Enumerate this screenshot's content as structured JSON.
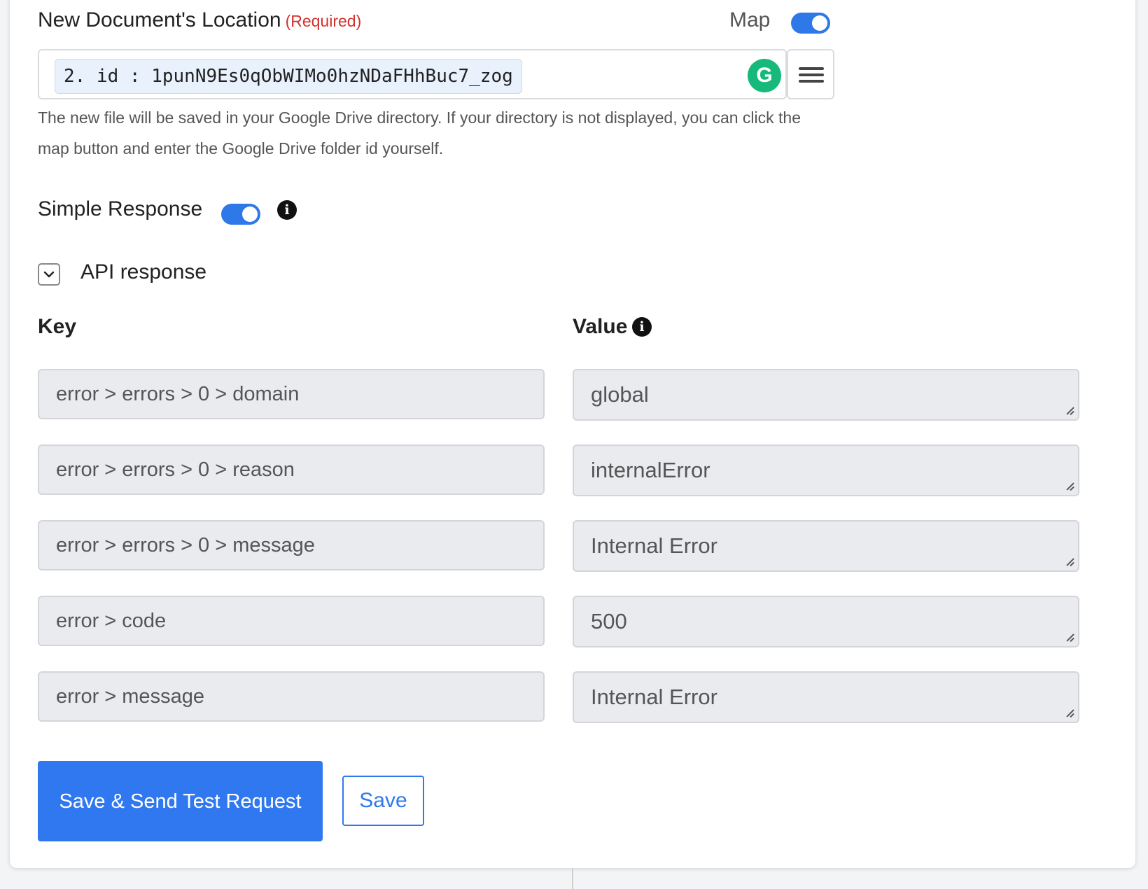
{
  "location": {
    "label": "New Document's Location",
    "required": "(Required)",
    "map_label": "Map",
    "map_enabled": true,
    "value_chip": "2. id : 1punN9Es0qObWIMo0hzNDaFHhBuc7_zog",
    "help_text": "The new file will be saved in your Google Drive directory. If your directory is not displayed, you can click the map button and enter the Google Drive folder id yourself."
  },
  "simple_response": {
    "label": "Simple Response",
    "enabled": true
  },
  "api_response": {
    "label": "API response",
    "key_header": "Key",
    "value_header": "Value",
    "rows": [
      {
        "key": "error > errors > 0 > domain",
        "value": "global"
      },
      {
        "key": "error > errors > 0 > reason",
        "value": "internalError"
      },
      {
        "key": "error > errors > 0 > message",
        "value": "Internal Error"
      },
      {
        "key": "error > code",
        "value": "500"
      },
      {
        "key": "error > message",
        "value": "Internal Error"
      }
    ]
  },
  "buttons": {
    "save_and_test": "Save & Send Test Request",
    "save": "Save"
  },
  "colors": {
    "accent": "#2f78f0",
    "required": "#d0312d",
    "grammarly": "#16b979"
  }
}
